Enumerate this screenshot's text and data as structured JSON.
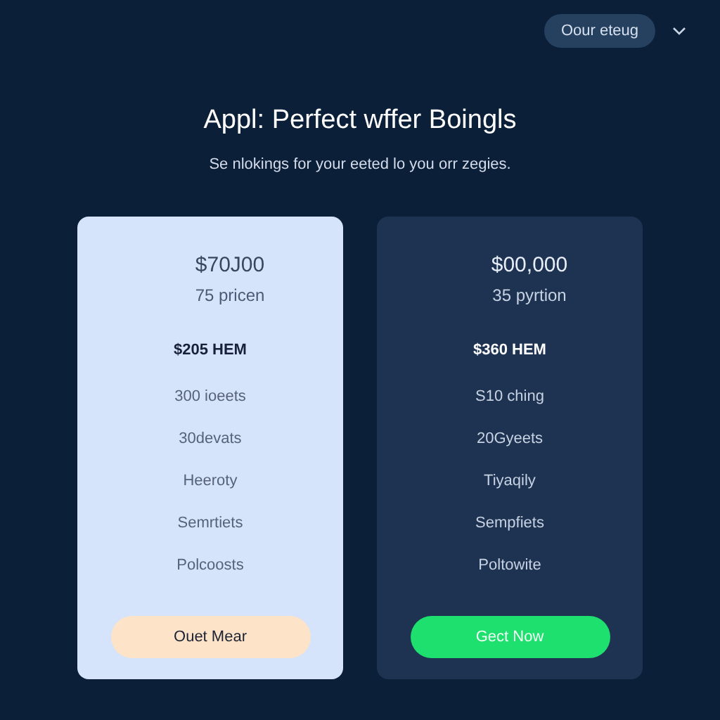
{
  "header": {
    "menu_button": "Oour eteug"
  },
  "title": "Appl: Perfect wffer Boingls",
  "subtitle": "Se nlokings for your eeted lo you orr zegies.",
  "plans": [
    {
      "kind": "light",
      "price": "$70J00",
      "period": "75 pricen",
      "headline": "$205 HEM",
      "features": [
        "300 ioeets",
        "30devats",
        "Heeroty",
        "Semrtiets",
        "Polcoosts"
      ],
      "button": "Ouet Mear"
    },
    {
      "kind": "dark",
      "price": "$00,000",
      "period": "35 pyrtion",
      "headline": "$360 HEM",
      "features": [
        "S10 ching",
        "20Gyeets",
        "Tiyaqily",
        "Sempfiets",
        "Poltowite"
      ],
      "button": "Gect Now"
    }
  ]
}
